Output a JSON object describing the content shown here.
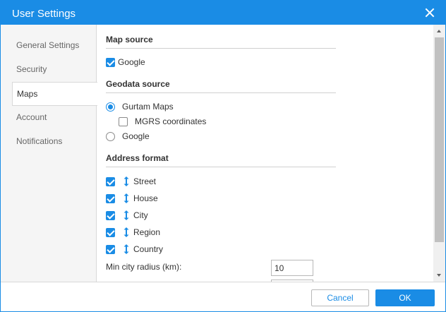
{
  "window": {
    "title": "User Settings",
    "accent_color": "#1a8ce5"
  },
  "sidebar": {
    "items": [
      {
        "label": "General Settings",
        "active": false
      },
      {
        "label": "Security",
        "active": false
      },
      {
        "label": "Maps",
        "active": true
      },
      {
        "label": "Account",
        "active": false
      },
      {
        "label": "Notifications",
        "active": false
      }
    ]
  },
  "map_source": {
    "title": "Map source",
    "options": [
      {
        "label": "Google",
        "checked": true
      }
    ]
  },
  "geodata_source": {
    "title": "Geodata source",
    "gurtam": {
      "label": "Gurtam Maps",
      "selected": true
    },
    "mgrs": {
      "label": "MGRS coordinates",
      "checked": false
    },
    "google": {
      "label": "Google",
      "selected": false
    }
  },
  "address_format": {
    "title": "Address format",
    "items": [
      {
        "label": "Street",
        "checked": true
      },
      {
        "label": "House",
        "checked": true
      },
      {
        "label": "City",
        "checked": true
      },
      {
        "label": "Region",
        "checked": true
      },
      {
        "label": "Country",
        "checked": true
      }
    ],
    "min_city_radius": {
      "label": "Min city radius (km):",
      "value": "10"
    },
    "next_field": {
      "value": ""
    }
  },
  "footer": {
    "cancel_label": "Cancel",
    "ok_label": "OK"
  }
}
